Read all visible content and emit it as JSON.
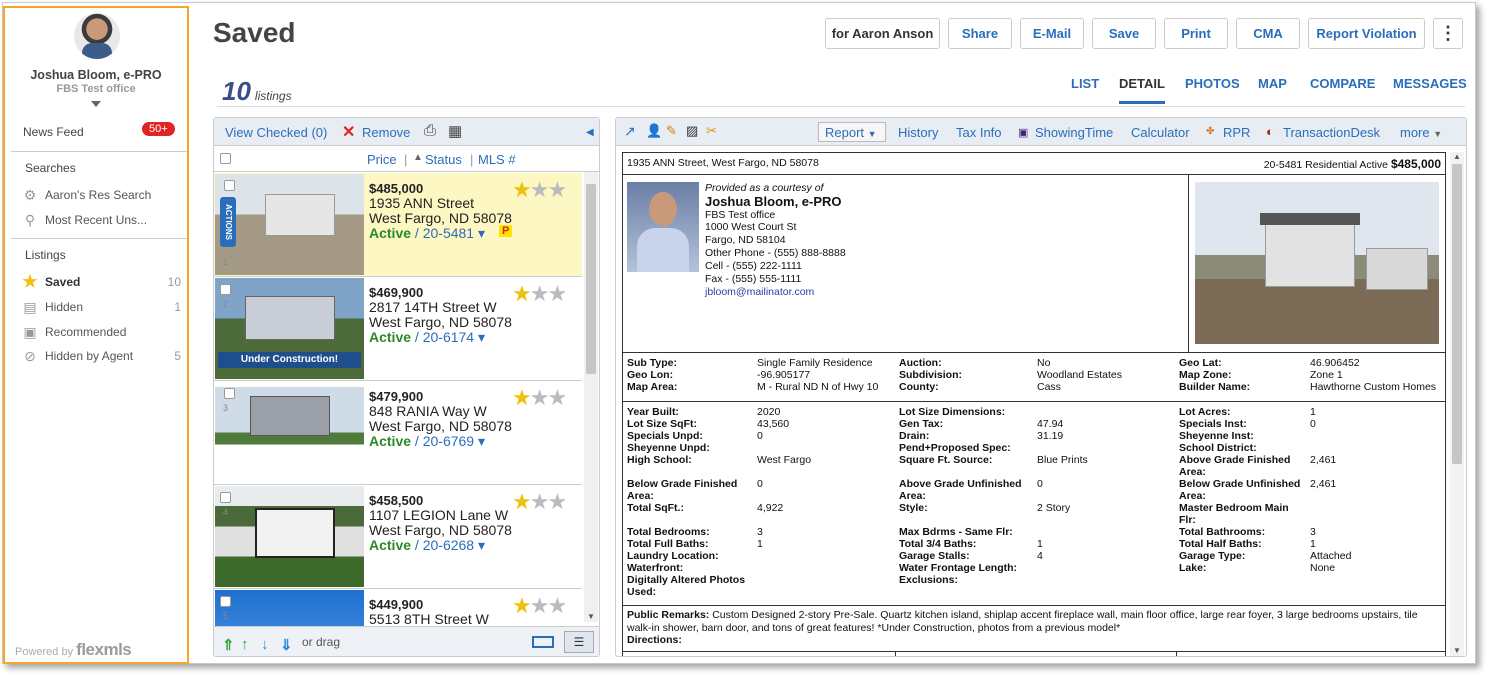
{
  "sidebar": {
    "agent_name": "Joshua Bloom, e-PRO",
    "office": "FBS Test office",
    "news_feed": "News Feed",
    "news_badge": "50+",
    "searches_heading": "Searches",
    "searches": [
      {
        "label": "Aaron's Res Search",
        "icon": "saved-search-icon"
      },
      {
        "label": "Most Recent Uns...",
        "icon": "search-icon"
      }
    ],
    "listings_heading": "Listings",
    "listings": [
      {
        "label": "Saved",
        "count": "10",
        "icon": "star-icon"
      },
      {
        "label": "Hidden",
        "count": "1",
        "icon": "hidden-icon"
      },
      {
        "label": "Recommended",
        "count": "",
        "icon": "briefcase-icon"
      },
      {
        "label": "Hidden by Agent",
        "count": "5",
        "icon": "no-icon"
      }
    ],
    "powered_by": "Powered by",
    "powered_brand": "flexmls"
  },
  "header": {
    "title": "Saved",
    "count": "10",
    "count_label": "listings",
    "buttons": {
      "for": "for Aaron Anson",
      "share": "Share",
      "email": "E-Mail",
      "save": "Save",
      "print": "Print",
      "cma": "CMA",
      "report": "Report Violation"
    },
    "tabs": [
      "LIST",
      "DETAIL",
      "PHOTOS",
      "MAP",
      "COMPARE",
      "MESSAGES"
    ],
    "active_tab": "DETAIL"
  },
  "list_panel": {
    "view_checked": "View Checked (0)",
    "remove": "Remove",
    "columns": {
      "price": "Price",
      "status": "Status",
      "mls": "MLS #"
    },
    "actions_label": "ACTIONS",
    "listings": [
      {
        "num": "1",
        "price": "$485,000",
        "street": "1935 ANN Street",
        "city": "West Fargo, ND 58078",
        "status": "Active",
        "mls": "20-5481",
        "flag": "P",
        "stars": 1
      },
      {
        "num": "2",
        "price": "$469,900",
        "street": "2817 14TH Street W",
        "city": "West Fargo, ND 58078",
        "status": "Active",
        "mls": "20-6174",
        "banner": "Under Construction!",
        "stars": 1
      },
      {
        "num": "3",
        "price": "$479,900",
        "street": "848 RANIA Way W",
        "city": "West Fargo, ND 58078",
        "status": "Active",
        "mls": "20-6769",
        "stars": 1
      },
      {
        "num": "4",
        "price": "$458,500",
        "street": "1107 LEGION Lane W",
        "city": "West Fargo, ND 58078",
        "status": "Active",
        "mls": "20-6268",
        "stars": 1
      },
      {
        "num": "5",
        "price": "$449,900",
        "street": "5513 8TH Street W",
        "city": "",
        "status": "",
        "mls": "",
        "stars": 1
      }
    ],
    "footer_drag": "or drag"
  },
  "detail_panel": {
    "toolbar": {
      "report": "Report",
      "history": "History",
      "tax": "Tax Info",
      "showing": "ShowingTime",
      "calc": "Calculator",
      "rpr": "RPR",
      "td": "TransactionDesk",
      "more": "more"
    },
    "report": {
      "address_line": "1935 ANN Street, West Fargo, ND 58078",
      "header_mls": "20-5481 Residential Active ",
      "header_price": "$485,000",
      "courtesy": "Provided as a courtesy of",
      "agent": "Joshua Bloom, e-PRO",
      "office": "FBS Test office",
      "street": "1000 West Court St",
      "cityline": "Fargo, ND 58104",
      "other_phone": "Other Phone - (555) 888-8888",
      "cell": "Cell - (555) 222-1111",
      "fax": "Fax - (555) 555-1111",
      "email": "jbloom@mailinator.com",
      "section1": [
        [
          {
            "l": "Sub Type:",
            "v": "Single Family Residence"
          },
          {
            "l": "Auction:",
            "v": "No"
          },
          {
            "l": "Geo Lat:",
            "v": "46.906452"
          }
        ],
        [
          {
            "l": "Geo Lon:",
            "v": "-96.905177"
          },
          {
            "l": "Subdivision:",
            "v": "Woodland Estates"
          },
          {
            "l": "Map Zone:",
            "v": "Zone 1"
          }
        ],
        [
          {
            "l": "Map Area:",
            "v": "M - Rural ND N of Hwy 10"
          },
          {
            "l": "County:",
            "v": "Cass"
          },
          {
            "l": "Builder Name:",
            "v": "Hawthorne Custom Homes"
          }
        ]
      ],
      "section2": [
        [
          {
            "l": "Year Built:",
            "v": "2020"
          },
          {
            "l": "Lot Size Dimensions:",
            "v": ""
          },
          {
            "l": "Lot Acres:",
            "v": "1"
          }
        ],
        [
          {
            "l": "Lot Size SqFt:",
            "v": "43,560"
          },
          {
            "l": "Gen Tax:",
            "v": "47.94"
          },
          {
            "l": "Specials Inst:",
            "v": "0"
          }
        ],
        [
          {
            "l": "Specials Unpd:",
            "v": "0"
          },
          {
            "l": "Drain:",
            "v": "31.19"
          },
          {
            "l": "Sheyenne Inst:",
            "v": ""
          }
        ],
        [
          {
            "l": "Sheyenne Unpd:",
            "v": ""
          },
          {
            "l": "Pend+Proposed Spec:",
            "v": ""
          },
          {
            "l": "School District:",
            "v": ""
          }
        ],
        [
          {
            "l": "High School:",
            "v": "West Fargo"
          },
          {
            "l": "Square Ft. Source:",
            "v": "Blue Prints"
          },
          {
            "l": "Above Grade Finished Area:",
            "v": "2,461"
          }
        ],
        [
          {
            "l": "Below Grade Finished Area:",
            "v": "0"
          },
          {
            "l": "Above Grade Unfinished Area:",
            "v": "0"
          },
          {
            "l": "Below Grade Unfinished Area:",
            "v": "2,461"
          }
        ],
        [
          {
            "l": "Total SqFt.:",
            "v": "4,922"
          },
          {
            "l": "Style:",
            "v": "2 Story"
          },
          {
            "l": "Master Bedroom Main Flr:",
            "v": ""
          }
        ],
        [
          {
            "l": "Total Bedrooms:",
            "v": "3"
          },
          {
            "l": "Max Bdrms - Same Flr:",
            "v": ""
          },
          {
            "l": "Total Bathrooms:",
            "v": "3"
          }
        ],
        [
          {
            "l": "Total Full Baths:",
            "v": "1"
          },
          {
            "l": "Total 3/4 Baths:",
            "v": "1"
          },
          {
            "l": "Total Half Baths:",
            "v": "1"
          }
        ],
        [
          {
            "l": "Laundry Location:",
            "v": ""
          },
          {
            "l": "Garage Stalls:",
            "v": "4"
          },
          {
            "l": "Garage Type:",
            "v": "Attached"
          }
        ],
        [
          {
            "l": "Waterfront:",
            "v": ""
          },
          {
            "l": "Water Frontage Length:",
            "v": ""
          },
          {
            "l": "Lake:",
            "v": "None"
          }
        ],
        [
          {
            "l": "Digitally Altered Photos Used:",
            "v": ""
          },
          {
            "l": "Exclusions:",
            "v": ""
          },
          {
            "l": "",
            "v": ""
          }
        ]
      ],
      "remarks_label": "Public Remarks:",
      "remarks": "Custom Designed 2-story Pre-Sale. Quartz kitchen island, shiplap accent fireplace wall, main floor office, large rear foyer, 3 large bedrooms upstairs, tile walk-in shower, barn door, and tons of great features! *Under Construction, photos from a previous model*",
      "directions_label": "Directions:"
    }
  },
  "colors": {
    "accent": "#2a6ebb",
    "sidebar_border": "#f5a623",
    "selected_row": "#fdf7c3",
    "active_status": "#2a8a2a"
  }
}
